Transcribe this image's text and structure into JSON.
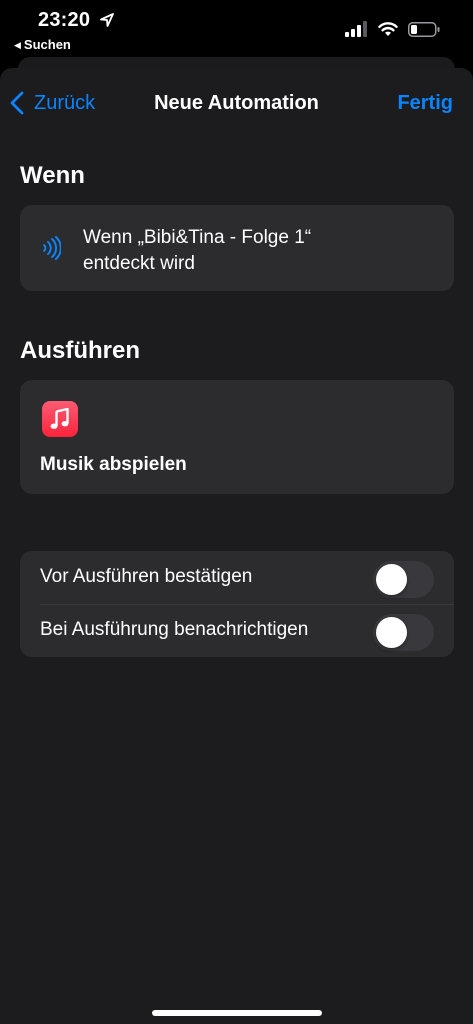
{
  "status_bar": {
    "time": "23:20",
    "back_app": "Suchen",
    "icons": [
      "location-arrow-icon",
      "signal-icon",
      "wifi-icon",
      "battery-icon"
    ]
  },
  "nav": {
    "back_label": "Zurück",
    "title": "Neue Automation",
    "done_label": "Fertig"
  },
  "when": {
    "header": "Wenn",
    "icon": "nfc-icon",
    "line1": "Wenn „Bibi&Tina - Folge 1“",
    "line2": "entdeckt wird"
  },
  "execute": {
    "header": "Ausführen",
    "icon": "music-app-icon",
    "action_label": "Musik abspielen"
  },
  "options": [
    {
      "label": "Vor Ausführen bestätigen",
      "enabled": false
    },
    {
      "label": "Bei Ausführung benachrichtigen",
      "enabled": false
    }
  ],
  "colors": {
    "accent": "#0a84ff",
    "background": "#1c1c1e",
    "card": "#2c2c2e",
    "music_red": "#fa233b"
  }
}
